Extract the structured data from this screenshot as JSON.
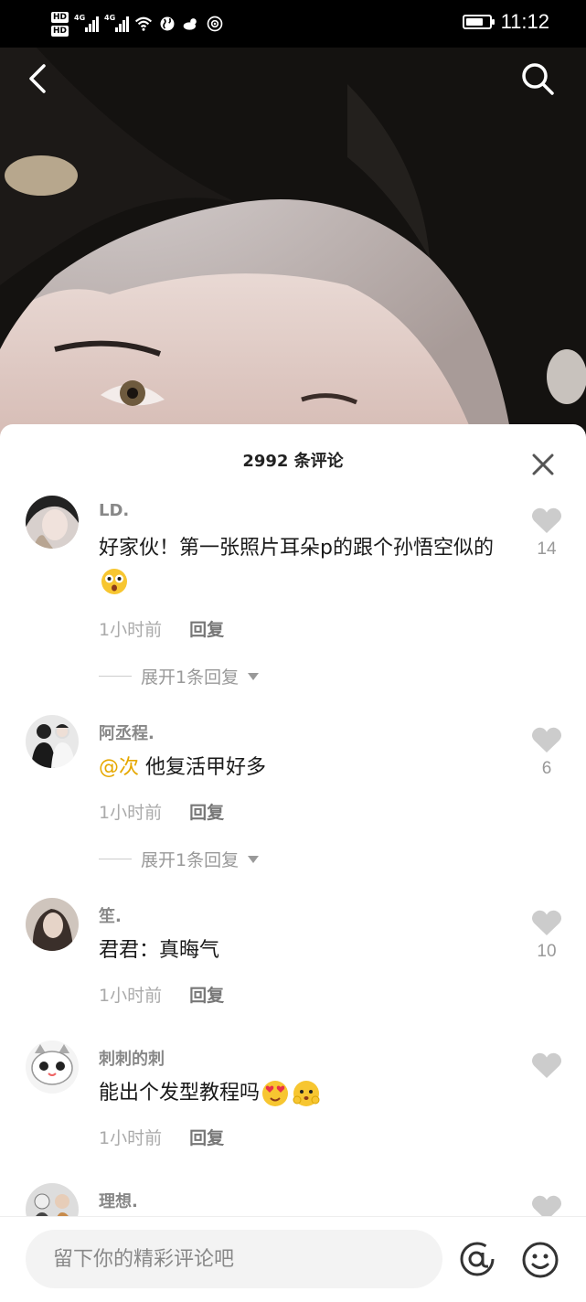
{
  "status_bar": {
    "hd1": "HD",
    "hd2": "HD",
    "net1": "4G",
    "net2": "4G",
    "time": "11:12",
    "battery_level": 0.75
  },
  "header": {
    "back_icon": "chevron-left-icon",
    "search_icon": "search-icon"
  },
  "sheet": {
    "title": "2992 条评论",
    "close_icon": "close-icon"
  },
  "comments": [
    {
      "username": "LD.",
      "text_parts": [
        "好家伙！第一张照片耳朵p的跟个孙悟空似的"
      ],
      "emojis": [
        "astonished-emoji"
      ],
      "time": "1小时前",
      "reply_label": "回复",
      "likes": "14",
      "expand_label": "展开1条回复"
    },
    {
      "username": "阿丞程.",
      "mention": "@次",
      "text_parts": [
        " 他复活甲好多"
      ],
      "time": "1小时前",
      "reply_label": "回复",
      "likes": "6",
      "expand_label": "展开1条回复"
    },
    {
      "username": "笙.",
      "text_parts": [
        "君君：真晦气"
      ],
      "time": "1小时前",
      "reply_label": "回复",
      "likes": "10"
    },
    {
      "username": "刺刺的刺",
      "text_parts": [
        "能出个发型教程吗"
      ],
      "emojis": [
        "heart-eyes-emoji",
        "shy-emoji"
      ],
      "time": "1小时前",
      "reply_label": "回复",
      "likes": ""
    },
    {
      "username": "理想.",
      "likes": ""
    }
  ],
  "input": {
    "placeholder": "留下你的精彩评论吧",
    "at_icon": "at-icon",
    "emoji_icon": "smiley-icon"
  },
  "colors": {
    "mention": "#e6a800",
    "username": "#888888",
    "heart": "#cccccc"
  }
}
